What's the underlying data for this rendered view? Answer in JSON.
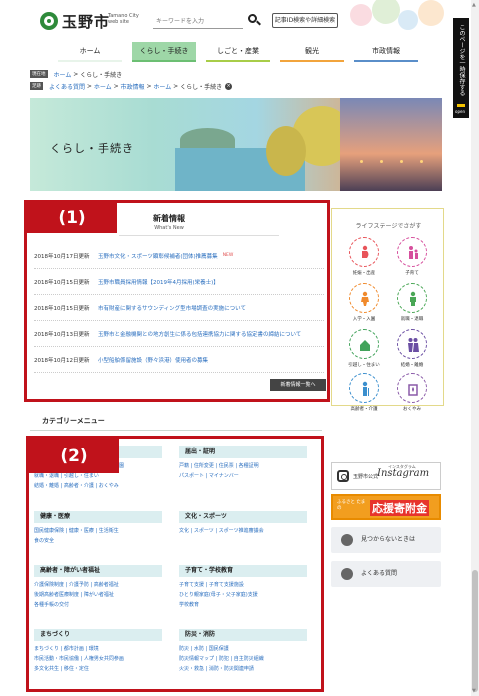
{
  "header": {
    "logo_ja": "玉野市",
    "logo_en": "Tamano City web site",
    "search_placeholder": "キーワードを入力",
    "id_search_label": "記事ID検索や詳細検索"
  },
  "nav": {
    "items": [
      {
        "label": "ホーム",
        "bar": "#e8f4ea"
      },
      {
        "label": "くらし・手続き",
        "bar": "#6cbf73"
      },
      {
        "label": "しごと・産業",
        "bar": "#a8cd48"
      },
      {
        "label": "観光",
        "bar": "#f2a43c"
      },
      {
        "label": "市政情報",
        "bar": "#5a8ec9"
      }
    ]
  },
  "breadcrumbs": {
    "current_tag": "現在地",
    "current": [
      "ホーム",
      "くらし・手続き"
    ],
    "history_tag": "足跡",
    "history": [
      "よくある質問",
      "ホーム",
      "市政情報",
      "ホーム",
      "くらし・手続き"
    ]
  },
  "hero": {
    "title": "くらし・手続き"
  },
  "news": {
    "title": "新着情報",
    "subtitle": "What's New",
    "items": [
      {
        "date": "2018年10月17日更新",
        "text": "玉野市文化・スポーツ顕彰候補者(団体)推薦募集",
        "new": "NEW"
      },
      {
        "date": "2018年10月15日更新",
        "text": "玉野市職員採用情報【2019年4月採用(栄養士)】",
        "new": ""
      },
      {
        "date": "2018年10月15日更新",
        "text": "市有財産に関するサウンディング型市場調査の実施について",
        "new": ""
      },
      {
        "date": "2018年10月13日更新",
        "text": "玉野市と金融機関との地方創生に係る包括連携協力に関する協定書の締結について",
        "new": ""
      },
      {
        "date": "2018年10月12日更新",
        "text": "小型船舶係留施設（野々浜港）使用者の募集",
        "new": ""
      }
    ],
    "more": "新着情報一覧へ"
  },
  "callouts": {
    "one": "(1)",
    "two": "(2)"
  },
  "categories": {
    "heading": "カテゴリーメニュー",
    "blocks": [
      {
        "title": "",
        "links": [
          "戸籍・住民票・手続",
          "子・入園",
          "就職・退職",
          "引越し・住まい",
          "結婚・離婚",
          "高齢者・介護",
          "おくやみ"
        ]
      },
      {
        "title": "届出・証明",
        "links": [
          "戸籍",
          "住所変更",
          "住民票",
          "各種証明",
          "パスポート",
          "マイナンバー"
        ]
      },
      {
        "title": "健康・医療",
        "links": [
          "国民健康保険",
          "健康・医療",
          "生活衛生",
          "食の安全"
        ]
      },
      {
        "title": "文化・スポーツ",
        "links": [
          "文化",
          "スポーツ",
          "スポーツ推進審議会"
        ]
      },
      {
        "title": "高齢者・障がい者福祉",
        "links": [
          "介護保険制度",
          "介護予防",
          "高齢者福祉",
          "後期高齢者医療制度",
          "障がい者福祉",
          "各種手帳の交付"
        ]
      },
      {
        "title": "子育て・学校教育",
        "links": [
          "子育て支援",
          "子育て支援施設",
          "ひとり親家庭(母子・父子家庭)支援",
          "学校教育"
        ]
      },
      {
        "title": "まちづくり",
        "links": [
          "まちづくり",
          "都市計画",
          "環境",
          "市民活動・市民協働",
          "人権男女共同参画",
          "多文化共生",
          "移住・定住"
        ]
      },
      {
        "title": "防災・消防",
        "links": [
          "防災",
          "水防",
          "国民保護",
          "防災情報マップ",
          "防犯",
          "自主防災組織",
          "火災・救急",
          "消防・防災関連申請"
        ]
      }
    ]
  },
  "life_stage": {
    "title": "ライフステージでさがす",
    "items": [
      {
        "label": "妊娠・出産",
        "color": "#e8545a"
      },
      {
        "label": "子育て",
        "color": "#d64f9d"
      },
      {
        "label": "入学・入園",
        "color": "#f08a2c"
      },
      {
        "label": "就職・退職",
        "color": "#4aa756"
      },
      {
        "label": "引越し・住まい",
        "color": "#42a35b"
      },
      {
        "label": "結婚・離婚",
        "color": "#6a4ea3"
      },
      {
        "label": "高齢者・介護",
        "color": "#3b8fce"
      },
      {
        "label": "おくやみ",
        "color": "#8a5aa8"
      }
    ]
  },
  "banners": {
    "insta_small": "玉野市公式",
    "insta_label": "Instagram",
    "insta_top": "インスタグラム",
    "furusato_small": "ふるさと たまの",
    "furusato_main": "応援寄附金",
    "notfound": "見つからないときは",
    "faq": "よくある質問"
  },
  "save_tab": {
    "label": "このページを一時保存する",
    "open": "open"
  }
}
